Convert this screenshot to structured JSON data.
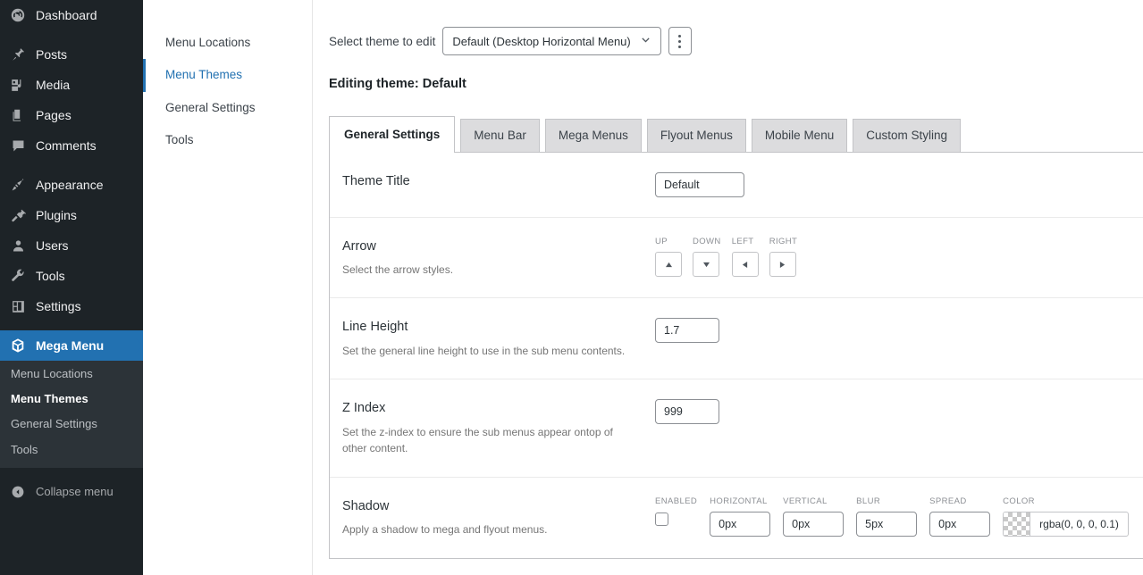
{
  "admin_sidebar": {
    "items": [
      {
        "label": "Dashboard",
        "icon": "dashboard-icon"
      },
      {
        "label": "Posts",
        "icon": "pin-icon"
      },
      {
        "label": "Media",
        "icon": "media-icon"
      },
      {
        "label": "Pages",
        "icon": "pages-icon"
      },
      {
        "label": "Comments",
        "icon": "comments-icon"
      },
      {
        "label": "Appearance",
        "icon": "brush-icon"
      },
      {
        "label": "Plugins",
        "icon": "plug-icon"
      },
      {
        "label": "Users",
        "icon": "user-icon"
      },
      {
        "label": "Tools",
        "icon": "wrench-icon"
      },
      {
        "label": "Settings",
        "icon": "settings-icon"
      }
    ],
    "current": {
      "label": "Mega Menu",
      "icon": "mega-menu-icon"
    },
    "submenu": [
      {
        "label": "Menu Locations",
        "current": false
      },
      {
        "label": "Menu Themes",
        "current": true
      },
      {
        "label": "General Settings",
        "current": false
      },
      {
        "label": "Tools",
        "current": false
      }
    ],
    "collapse_label": "Collapse menu",
    "accent_color": "#2271b1"
  },
  "subnav": {
    "items": [
      {
        "label": "Menu Locations",
        "current": false
      },
      {
        "label": "Menu Themes",
        "current": true
      },
      {
        "label": "General Settings",
        "current": false
      },
      {
        "label": "Tools",
        "current": false
      }
    ]
  },
  "theme_selector": {
    "label": "Select theme to edit",
    "selected": "Default (Desktop Horizontal Menu)",
    "editing_title": "Editing theme: Default"
  },
  "tabs": [
    {
      "label": "General Settings",
      "active": true
    },
    {
      "label": "Menu Bar",
      "active": false
    },
    {
      "label": "Mega Menus",
      "active": false
    },
    {
      "label": "Flyout Menus",
      "active": false
    },
    {
      "label": "Mobile Menu",
      "active": false
    },
    {
      "label": "Custom Styling",
      "active": false
    }
  ],
  "settings": {
    "theme_title": {
      "name": "Theme Title",
      "desc": "",
      "value": "Default"
    },
    "arrow": {
      "name": "Arrow",
      "desc": "Select the arrow styles.",
      "buttons": [
        {
          "label": "UP",
          "glyph": "triangle-up"
        },
        {
          "label": "DOWN",
          "glyph": "triangle-down"
        },
        {
          "label": "LEFT",
          "glyph": "triangle-left"
        },
        {
          "label": "RIGHT",
          "glyph": "triangle-right"
        }
      ]
    },
    "line_height": {
      "name": "Line Height",
      "desc": "Set the general line height to use in the sub menu contents.",
      "value": "1.7"
    },
    "z_index": {
      "name": "Z Index",
      "desc": "Set the z-index to ensure the sub menus appear ontop of other content.",
      "value": "999"
    },
    "shadow": {
      "name": "Shadow",
      "desc": "Apply a shadow to mega and flyout menus.",
      "enabled_label": "ENABLED",
      "horizontal_label": "HORIZONTAL",
      "horizontal_value": "0px",
      "vertical_label": "VERTICAL",
      "vertical_value": "0px",
      "blur_label": "BLUR",
      "blur_value": "5px",
      "spread_label": "SPREAD",
      "spread_value": "0px",
      "color_label": "COLOR",
      "color_value": "rgba(0, 0, 0, 0.1)"
    }
  }
}
